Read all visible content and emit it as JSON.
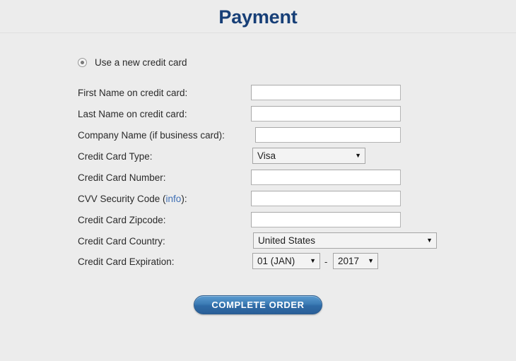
{
  "header": {
    "title": "Payment"
  },
  "payment_option": {
    "label": "Use a new credit card",
    "selected": true
  },
  "fields": {
    "first_name": {
      "label": "First Name on credit card:",
      "value": "",
      "placeholder": ""
    },
    "last_name": {
      "label": "Last Name on credit card:",
      "value": "",
      "placeholder": ""
    },
    "company_name": {
      "label": "Company Name (if business card):",
      "value": "",
      "placeholder": ""
    },
    "card_type": {
      "label": "Credit Card Type:",
      "value": "Visa"
    },
    "card_number": {
      "label": "Credit Card Number:",
      "value": "",
      "placeholder": ""
    },
    "cvv": {
      "label_before": "CVV Security Code (",
      "link": "info",
      "label_after": "):",
      "value": "",
      "placeholder": ""
    },
    "zipcode": {
      "label": "Credit Card Zipcode:",
      "value": "",
      "placeholder": ""
    },
    "country": {
      "label": "Credit Card Country:",
      "value": "United States"
    },
    "expiration": {
      "label": "Credit Card Expiration:",
      "month": "01 (JAN)",
      "separator": "-",
      "year": "2017"
    }
  },
  "actions": {
    "complete_order": "COMPLETE ORDER"
  },
  "icons": {
    "caret": "▼"
  },
  "colors": {
    "page_background": "#ececec",
    "title": "#173f77",
    "link": "#3f6fb5",
    "button_blue": "#3c7cb5",
    "text": "#2a2a2a"
  }
}
